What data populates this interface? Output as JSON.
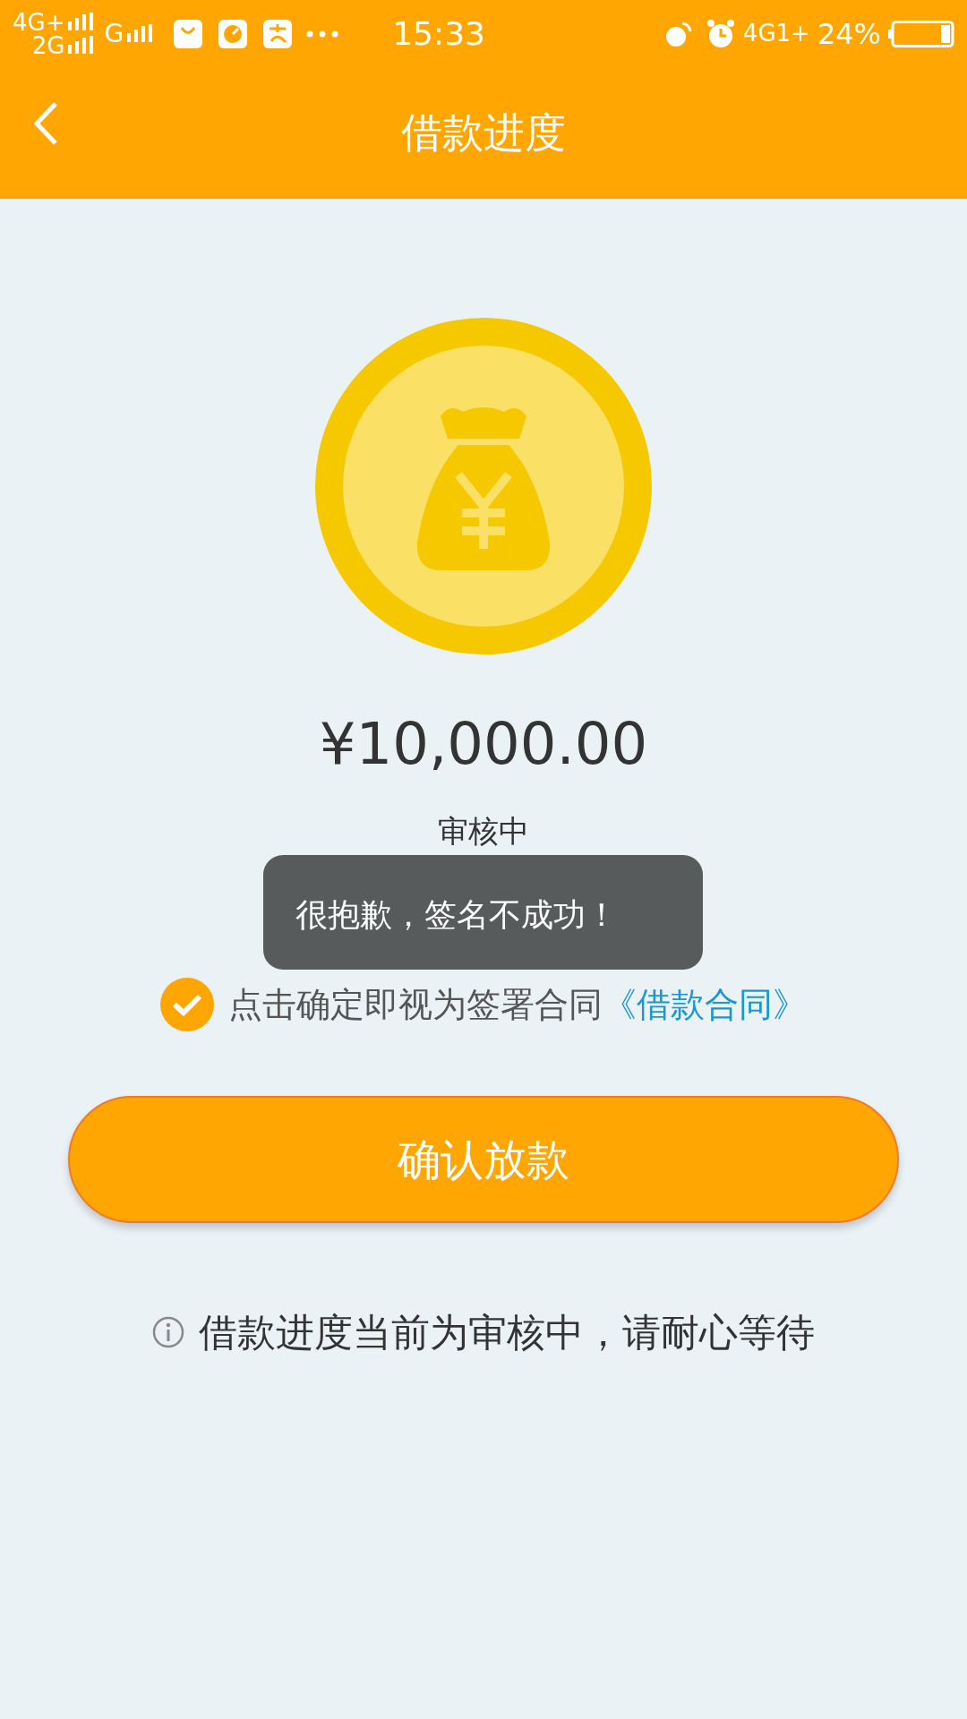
{
  "status_bar": {
    "sim1_network": "4G+",
    "sim2_network": "2G",
    "extra_network": "G",
    "time": "15:33",
    "data_network": "4G1+",
    "battery": "24%"
  },
  "header": {
    "title": "借款进度"
  },
  "loan": {
    "amount": "¥10,000.00",
    "status": "审核中"
  },
  "agreement": {
    "checked": true,
    "text": "点击确定即视为签署合同",
    "link": "《借款合同》"
  },
  "confirm_button": "确认放款",
  "notice": "借款进度当前为审核中，请耐心等待",
  "toast": "很抱歉，签名不成功！"
}
